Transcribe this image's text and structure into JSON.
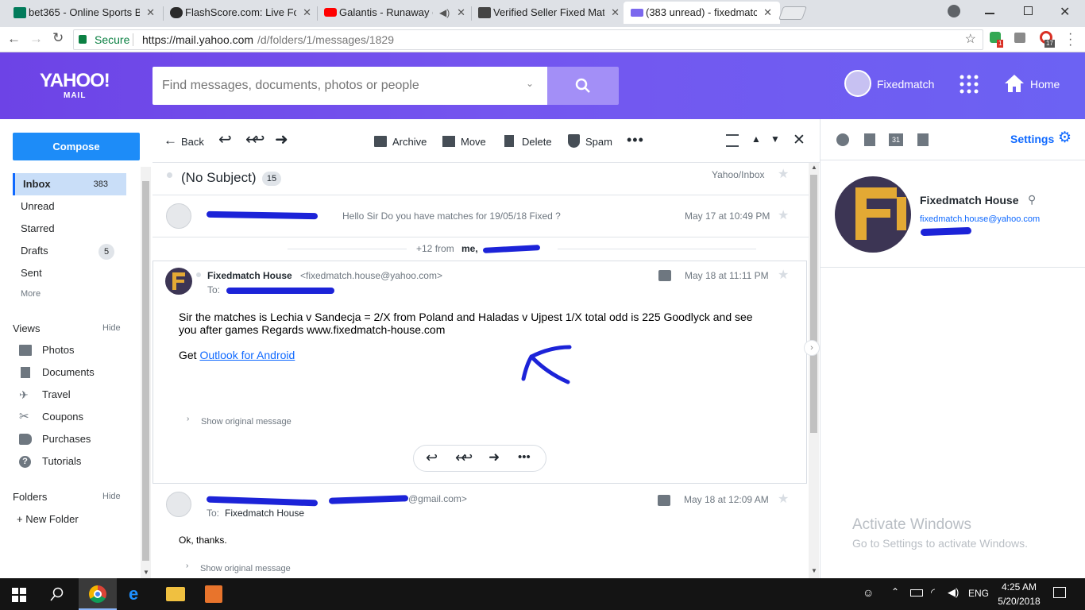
{
  "browser": {
    "tabs": [
      {
        "title": "bet365 - Online Sports Be",
        "favicon_color": "#027b5b"
      },
      {
        "title": "FlashScore.com: Live Foo",
        "favicon_color": "#2a2a2a"
      },
      {
        "title": "Galantis - Runaway (U",
        "favicon_color": "#ff0000"
      },
      {
        "title": "Verified Seller Fixed Matc",
        "favicon_color": "#444444"
      },
      {
        "title": "(383 unread) - fixedmatch",
        "favicon_color": "#7b68ee"
      }
    ],
    "secure_label": "Secure",
    "url_host": "https://mail.yahoo.com",
    "url_path": "/d/folders/1/messages/1829",
    "ext_badge_1": "1",
    "ext_badge_2": "17"
  },
  "header": {
    "logo_line1": "YAHOO!",
    "logo_line2": "MAIL",
    "search_placeholder": "Find messages, documents, photos or people",
    "username": "Fixedmatch",
    "home_label": "Home"
  },
  "nav": {
    "compose_label": "Compose",
    "folders": [
      {
        "label": "Inbox",
        "count": "383"
      },
      {
        "label": "Unread",
        "count": ""
      },
      {
        "label": "Starred",
        "count": ""
      },
      {
        "label": "Drafts",
        "count": "5"
      },
      {
        "label": "Sent",
        "count": ""
      }
    ],
    "more_label": "More",
    "views_label": "Views",
    "hide_label": "Hide",
    "views": [
      {
        "label": "Photos",
        "icon": "photos-icon"
      },
      {
        "label": "Documents",
        "icon": "document-icon"
      },
      {
        "label": "Travel",
        "icon": "plane-icon"
      },
      {
        "label": "Coupons",
        "icon": "scissors-icon"
      },
      {
        "label": "Purchases",
        "icon": "tag-icon"
      },
      {
        "label": "Tutorials",
        "icon": "help-icon"
      }
    ],
    "folders_label": "Folders",
    "new_folder_label": "+ New Folder"
  },
  "toolbar": {
    "back_label": "Back",
    "archive_label": "Archive",
    "move_label": "Move",
    "delete_label": "Delete",
    "spam_label": "Spam"
  },
  "thread": {
    "subject": "(No Subject)",
    "message_count": "15",
    "folder_path": "Yahoo/Inbox",
    "collapsed_1": {
      "preview": "Hello Sir Do you have matches for 19/05/18 Fixed ?",
      "date": "May 17 at 10:49 PM"
    },
    "more_from_prefix": "+12 from",
    "more_from_me": "me,",
    "expanded": {
      "sender_name": "Fixedmatch House",
      "sender_email": "<fixedmatch.house@yahoo.com>",
      "to_label": "To:",
      "date": "May 18 at 11:11 PM",
      "body": "Sir the matches is Lechia v Sandecja = 2/X from Poland and Haladas v Ujpest 1/X total odd is 225 Goodlyck and see you after games Regards www.fixedmatch-house.com",
      "get_prefix": "Get",
      "get_link": "Outlook for Android",
      "show_original": "Show original message"
    },
    "message_3": {
      "sender_email_suffix": "@gmail.com>",
      "to_label": "To:",
      "to_name": "Fixedmatch House",
      "date": "May 18 at 12:09 AM",
      "body": "Ok, thanks.",
      "show_original": "Show original message"
    }
  },
  "right_panel": {
    "settings_label": "Settings",
    "contact_name": "Fixedmatch House",
    "contact_email": "fixedmatch.house@yahoo.com"
  },
  "watermark": {
    "line1": "Activate Windows",
    "line2": "Go to Settings to activate Windows."
  },
  "taskbar": {
    "lang": "ENG",
    "time": "4:25 AM",
    "date": "5/20/2018"
  },
  "colors": {
    "accent": "#0f69ff",
    "header_purple": "#6d43e6",
    "link_blue": "#0f69ff",
    "annotation_blue": "#1c23d8"
  }
}
